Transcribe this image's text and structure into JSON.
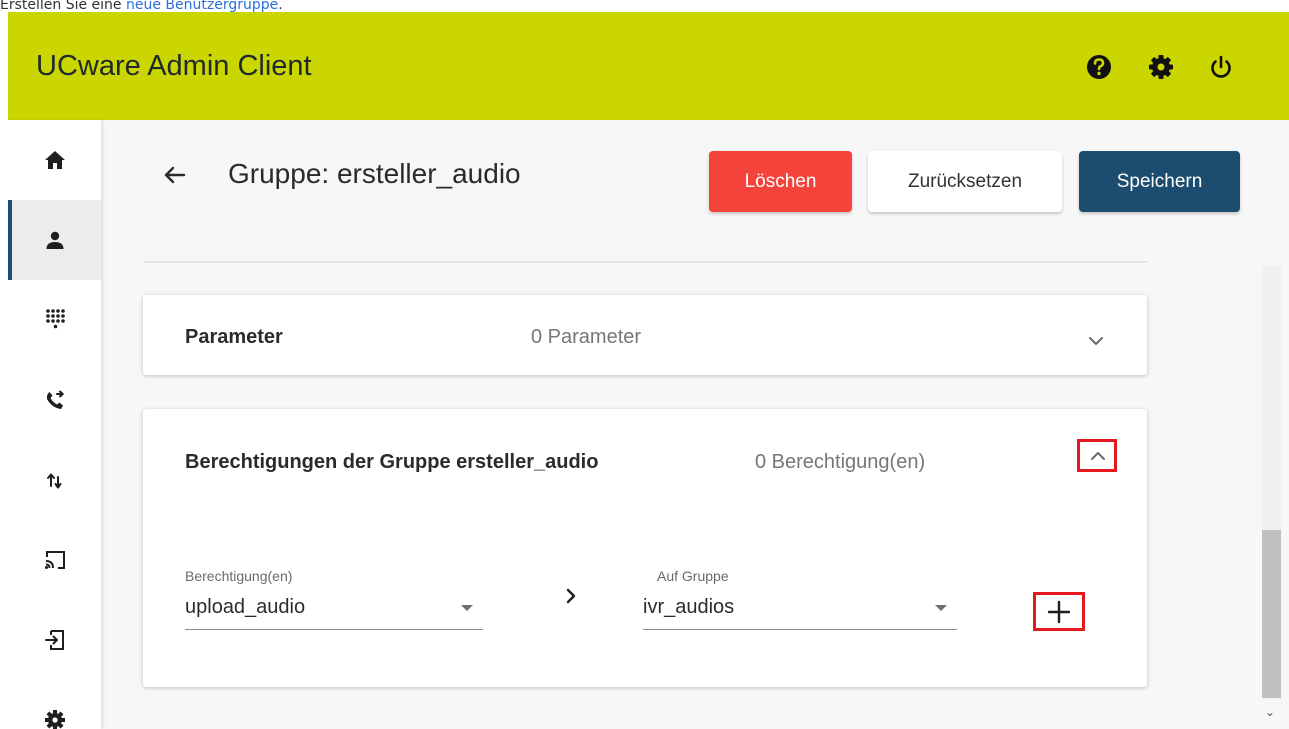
{
  "caption": {
    "prefix": "Erstellen Sie eine ",
    "link": "neue Benutzergruppe",
    "suffix": "."
  },
  "header": {
    "title": "UCware Admin Client",
    "icons": [
      "help-icon",
      "settings-gear-icon",
      "power-icon"
    ]
  },
  "sidebar": {
    "items": [
      {
        "icon": "home-icon",
        "active": false
      },
      {
        "icon": "user-icon",
        "active": true
      },
      {
        "icon": "dialpad-icon",
        "active": false
      },
      {
        "icon": "phone-forward-icon",
        "active": false
      },
      {
        "icon": "swap-arrows-icon",
        "active": false
      },
      {
        "icon": "cast-icon",
        "active": false
      },
      {
        "icon": "login-icon",
        "active": false
      },
      {
        "icon": "settings-gear-icon",
        "active": false
      }
    ]
  },
  "page": {
    "title": "Gruppe: ersteller_audio"
  },
  "actions": {
    "delete_label": "Löschen",
    "reset_label": "Zurücksetzen",
    "save_label": "Speichern"
  },
  "parameter_panel": {
    "title": "Parameter",
    "count": "0 Parameter",
    "expanded": false
  },
  "permissions_panel": {
    "title": "Berechtigungen der Gruppe ersteller_audio",
    "count": "0 Berechtigung(en)",
    "expanded": true,
    "permission_field": {
      "label": "Berechtigung(en)",
      "value": "upload_audio"
    },
    "group_field": {
      "label": "Auf Gruppe",
      "value": "ivr_audios"
    }
  },
  "colors": {
    "header": "#cbd500",
    "primary": "#1c4d70",
    "danger": "#f4433a",
    "highlight": "#e3191f"
  }
}
